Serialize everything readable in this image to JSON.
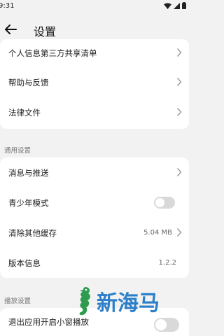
{
  "status_bar": {
    "time": "9:31"
  },
  "app_bar": {
    "title": "设置"
  },
  "group1": [
    {
      "label": "个人信息第三方共享清单",
      "has_arrow": true
    },
    {
      "label": "帮助与反馈",
      "has_arrow": true
    },
    {
      "label": "法律文件",
      "has_arrow": true
    }
  ],
  "general_settings": {
    "section_label": "通用设置",
    "items": [
      {
        "label": "消息与推送",
        "has_arrow": true
      },
      {
        "label": "青少年模式",
        "toggle": false
      },
      {
        "label": "清除其他缓存",
        "value": "5.04 MB",
        "has_arrow": true
      },
      {
        "label": "版本信息",
        "value": "1.2.2"
      }
    ]
  },
  "playback_settings": {
    "section_label": "播放设置",
    "items": [
      {
        "label": "退出应用开启小窗播放",
        "toggle": false
      }
    ]
  },
  "watermark": {
    "text": "新海马"
  },
  "colors": {
    "toggle_off": "#d9d9d9",
    "watermark": "#2c7fc8",
    "background": "#f2f2f2"
  }
}
